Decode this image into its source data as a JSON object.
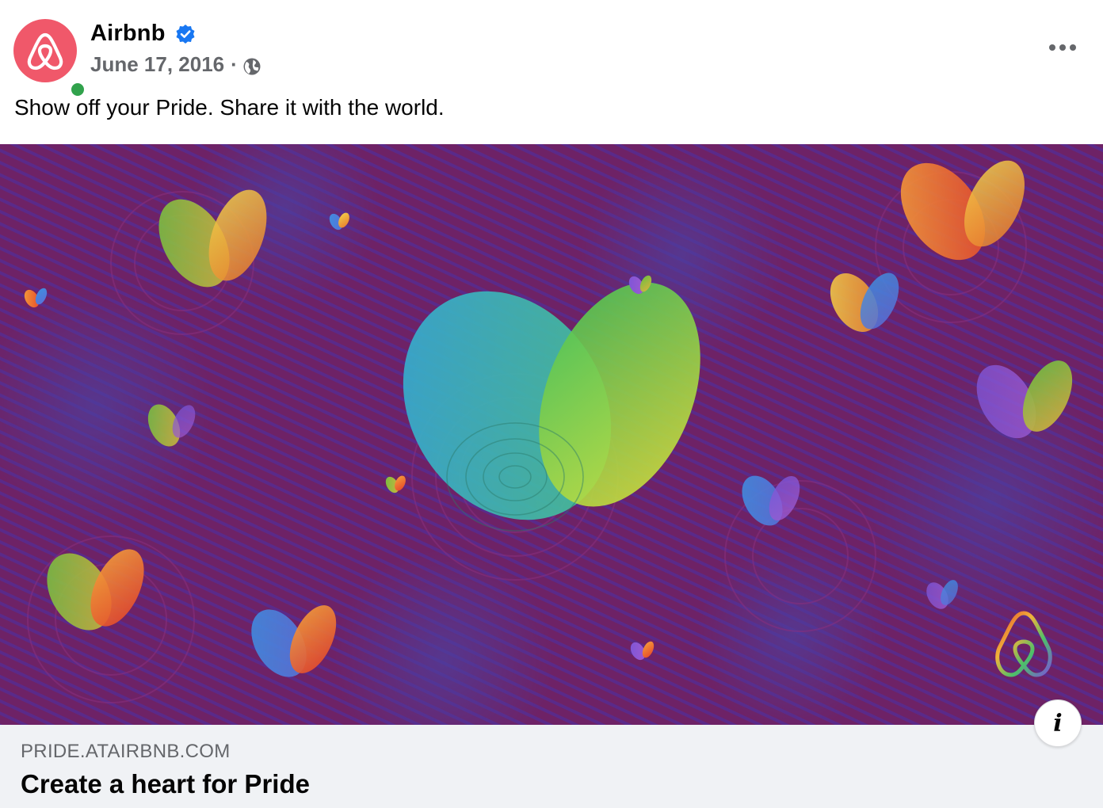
{
  "post": {
    "page_name": "Airbnb",
    "date": "June 17, 2016",
    "separator": "·",
    "audience_icon": "globe-icon",
    "verified_icon": "verified-badge-icon",
    "more_icon": "more-options-icon",
    "text": "Show off your Pride. Share it with the world."
  },
  "link": {
    "domain": "PRIDE.ATAIRBNB.COM",
    "title": "Create a heart for Pride",
    "info_label": "i"
  },
  "colors": {
    "brand": "#f0586a",
    "verified": "#1877f2",
    "online": "#31a24c",
    "secondary_text": "#65676b",
    "footer_bg": "#f0f2f5",
    "image_bg": "#6b2166"
  }
}
